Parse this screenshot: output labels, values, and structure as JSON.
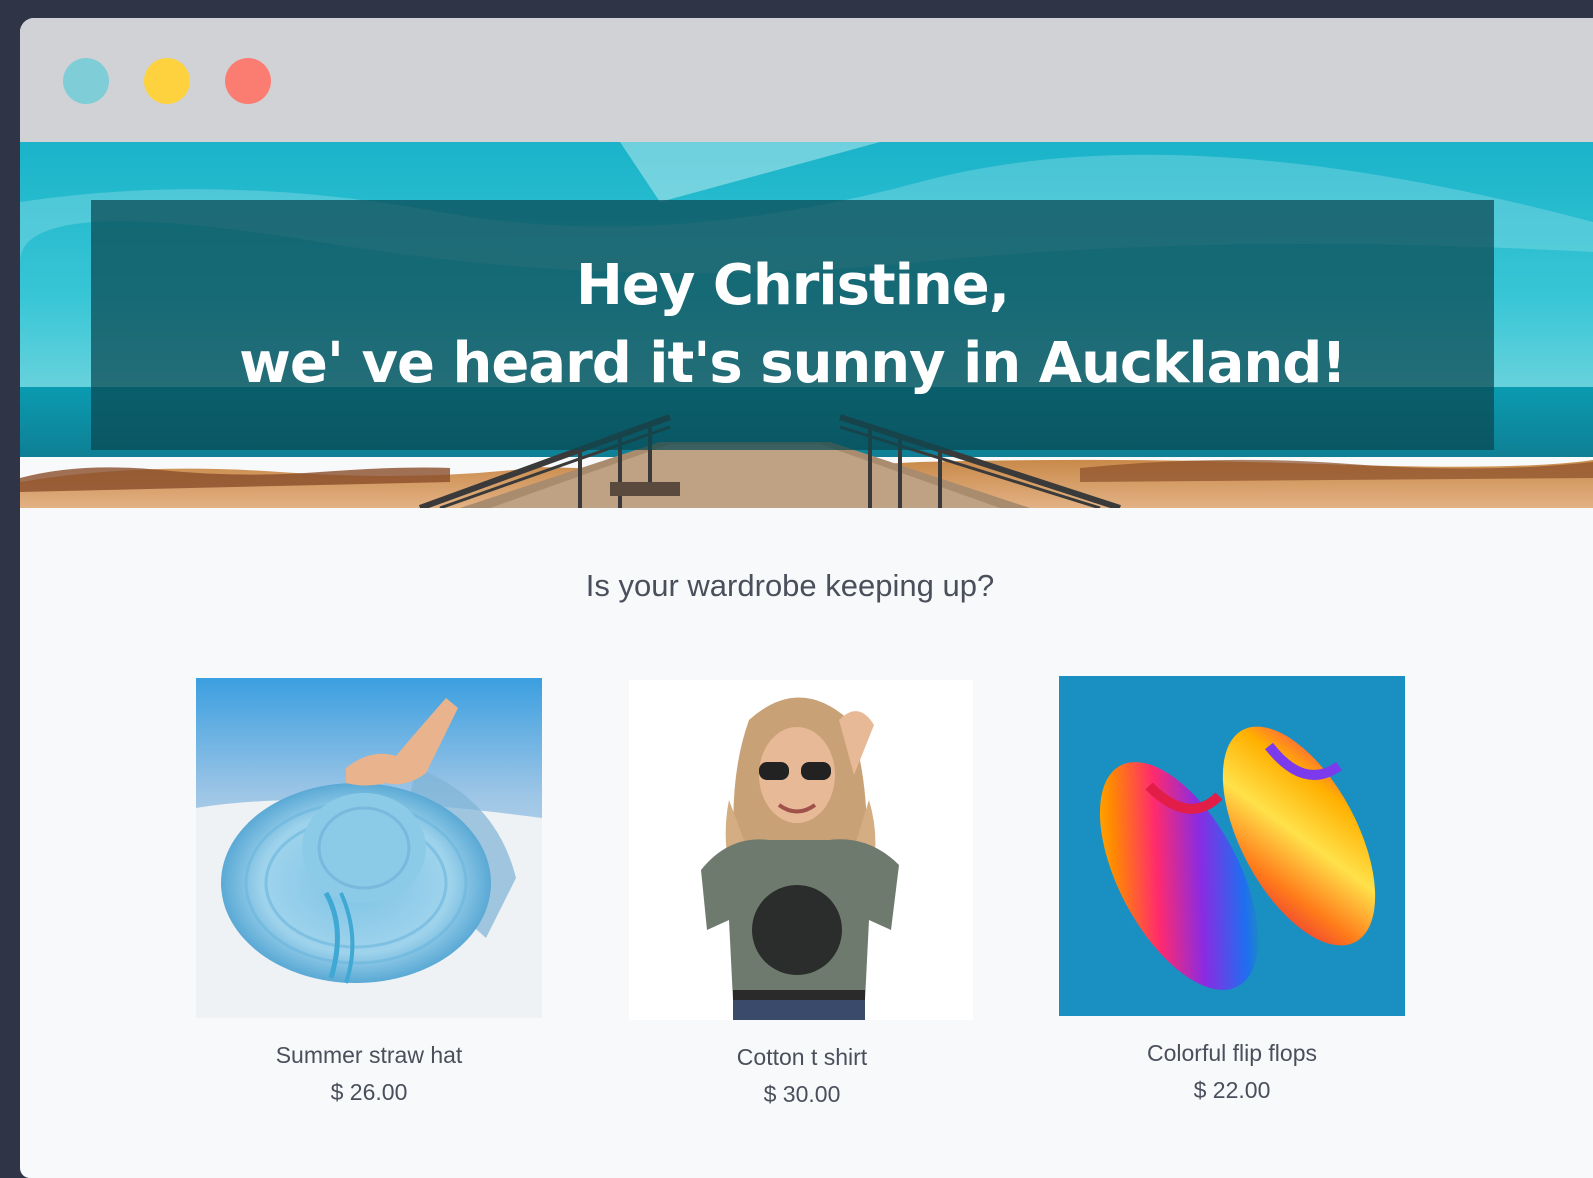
{
  "window": {
    "controls": [
      {
        "name": "teal",
        "color": "#7fcdd6"
      },
      {
        "name": "yellow",
        "color": "#fdd23e"
      },
      {
        "name": "red",
        "color": "#fb7d72"
      }
    ]
  },
  "hero": {
    "line1": "Hey Christine,",
    "line2": "we' ve heard it's sunny in Auckland!"
  },
  "subtitle": "Is your wardrobe keeping up?",
  "products": [
    {
      "name": "Summer straw hat",
      "price": "$ 26.00"
    },
    {
      "name": "Cotton t shirt",
      "price": "$ 30.00"
    },
    {
      "name": "Colorful flip flops",
      "price": "$ 22.00"
    }
  ],
  "colors": {
    "page_background": "#2f3447",
    "titlebar": "#d1d2d6",
    "content_background": "#f8f9fa",
    "hero_overlay": "#0a4650",
    "text": "#4a4f5c"
  }
}
